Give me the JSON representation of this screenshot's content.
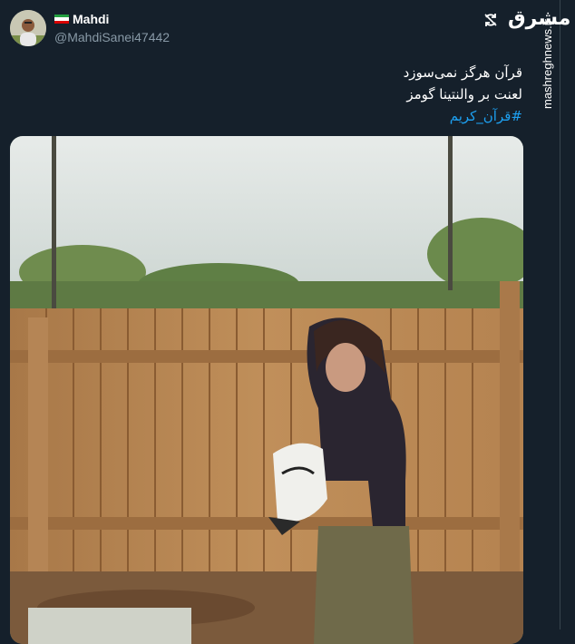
{
  "tweet": {
    "display_name": "Mahdi",
    "handle": "@MahdiSanei47442",
    "text_line_1": "قرآن هرگز نمی‌سوزد",
    "text_line_2": "لعنت بر والنتینا گومز",
    "hashtag": "#قرآن_کریم",
    "flag_icon": "iran-flag-icon",
    "retweet_icon": "retweet-icon",
    "media_description_icon": "video-thumbnail"
  },
  "watermark": {
    "logo_text": "مشرق",
    "url": "mashreghnews.ir"
  },
  "colors": {
    "background": "#15202b",
    "text_primary": "#ffffff",
    "text_secondary": "#8899a6",
    "link": "#1da1f2"
  }
}
